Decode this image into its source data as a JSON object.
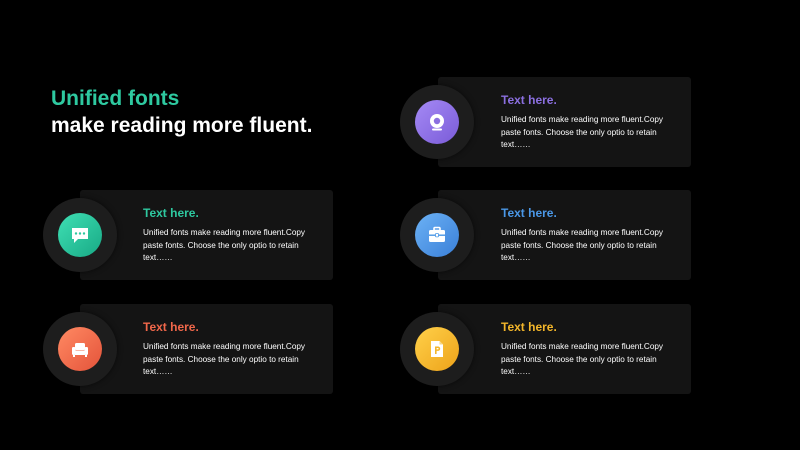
{
  "title": {
    "line1": "Unified fonts",
    "line2": "make reading more fluent."
  },
  "cards": [
    {
      "heading": "Text here.",
      "body": "Unified fonts make reading more fluent.Copy paste fonts. Choose the only optio to retain text……",
      "accent": "#8b6fe0",
      "icon": "webcam-icon"
    },
    {
      "heading": "Text here.",
      "body": "Unified fonts make reading more fluent.Copy paste fonts. Choose the only optio to retain text……",
      "accent": "#2ec9a0",
      "icon": "chat-bubble-icon"
    },
    {
      "heading": "Text here.",
      "body": "Unified fonts make reading more fluent.Copy paste fonts. Choose the only optio to retain text……",
      "accent": "#4a97e6",
      "icon": "briefcase-icon"
    },
    {
      "heading": "Text here.",
      "body": "Unified fonts make reading more fluent.Copy paste fonts. Choose the only optio to retain text……",
      "accent": "#f0674a",
      "icon": "sofa-icon"
    },
    {
      "heading": "Text here.",
      "body": "Unified fonts make reading more fluent.Copy paste fonts. Choose the only optio to retain text……",
      "accent": "#f3b62a",
      "icon": "document-icon"
    }
  ]
}
